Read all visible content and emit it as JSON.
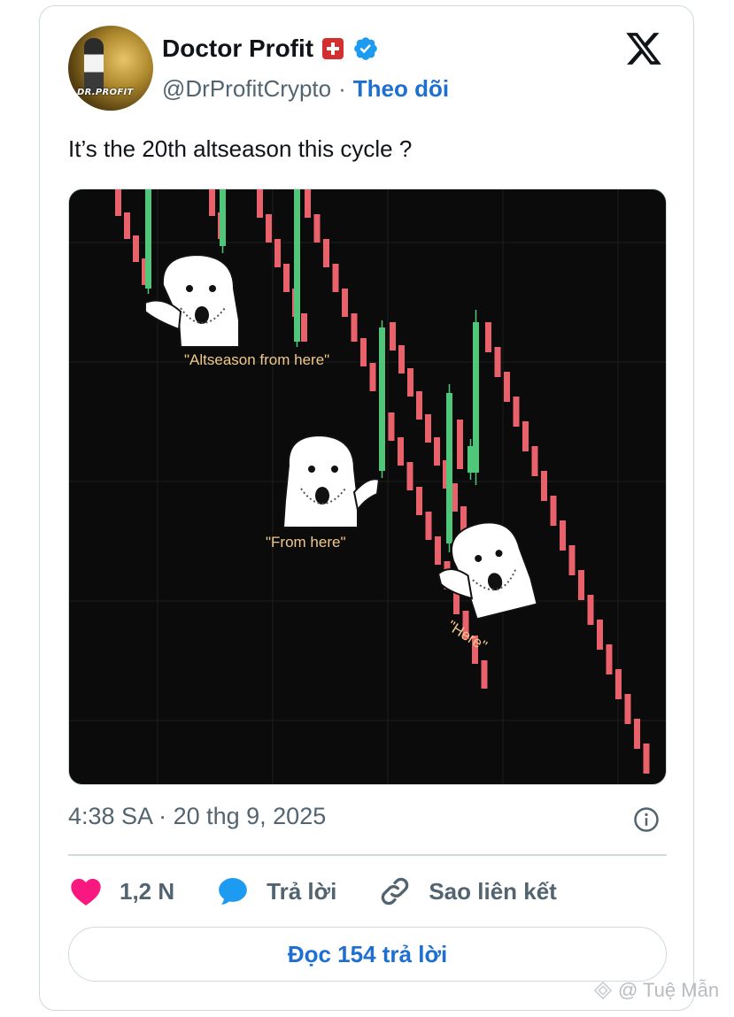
{
  "post": {
    "display_name": "Doctor Profit",
    "handle": "@DrProfitCrypto",
    "separator": "·",
    "follow_label": "Theo dõi",
    "avatar_text": "DR.PROFIT",
    "text": "It’s the 20th altseason this cycle ?",
    "timestamp": "4:38 SA · 20 thg 9, 2025"
  },
  "meme": {
    "caption1": "\"Altseason from here\"",
    "caption2": "\"From here\"",
    "caption3": "\"Here\""
  },
  "actions": {
    "like_count": "1,2 N",
    "reply_label": "Trả lời",
    "copy_link_label": "Sao liên kết"
  },
  "read_replies_label": "Đọc 154 trả lời",
  "watermark": "@ Tuệ Mẫn",
  "icons": {
    "verified": "verified-badge-icon",
    "flag": "swiss-flag-icon",
    "x_logo": "x-logo-icon",
    "info": "info-icon",
    "heart": "heart-icon",
    "reply": "reply-bubble-icon",
    "link": "link-icon"
  },
  "colors": {
    "accent": "#1d6fd1",
    "heart": "#f91880",
    "reply": "#1d9bf0",
    "candle_red": "#e8616b",
    "candle_green": "#4fc67a",
    "caption": "#f0c98a"
  }
}
